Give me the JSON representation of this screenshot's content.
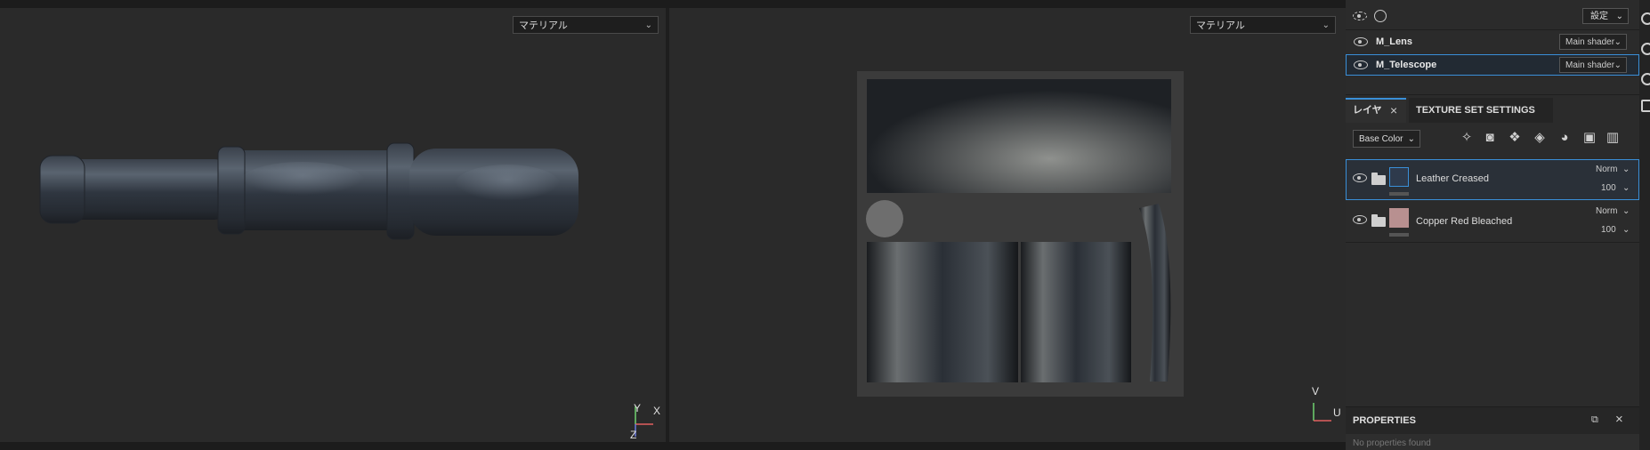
{
  "viewport3d": {
    "material_select": "マテリアル",
    "axis": {
      "y": "Y",
      "x": "X",
      "z": "Z"
    }
  },
  "viewport2d": {
    "material_select": "マテリアル",
    "axis": {
      "v": "V",
      "u": "U"
    }
  },
  "texture_sets": {
    "settings_button": "設定",
    "items": [
      {
        "name": "M_Lens",
        "shader": "Main shader"
      },
      {
        "name": "M_Telescope",
        "shader": "Main shader",
        "selected": true
      }
    ]
  },
  "layers_panel": {
    "tab_layers": "レイヤ",
    "tab_texture_set_settings": "TEXTURE SET SETTINGS",
    "channel_select": "Base Color",
    "tools": [
      "magic-wand-icon",
      "mask-icon",
      "fill-layer-icon",
      "paint-bucket-icon",
      "smart-material-icon",
      "add-folder-icon",
      "trash-icon"
    ],
    "layers": [
      {
        "name": "Leather Creased",
        "blend": "Norm",
        "opacity": "100",
        "thumb_color": "#2e3a4c",
        "selected": true
      },
      {
        "name": "Copper Red Bleached",
        "blend": "Norm",
        "opacity": "100",
        "thumb_color": "#b89090"
      }
    ]
  },
  "properties": {
    "title": "PROPERTIES",
    "empty_text": "No properties found"
  },
  "colors": {
    "accent": "#3a8fd8",
    "panel": "#2b2b2b",
    "viewport": "#2a2a2a"
  }
}
